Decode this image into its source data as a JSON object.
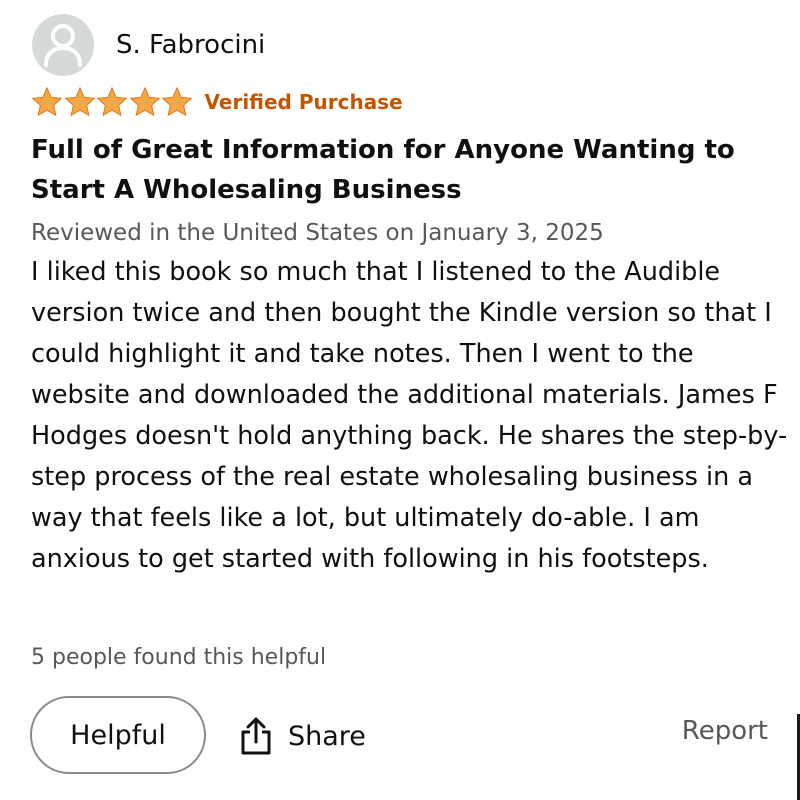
{
  "reviewer": {
    "name": "S. Fabrocini"
  },
  "rating": {
    "stars": 5,
    "max": 5,
    "badge": "Verified Purchase"
  },
  "review": {
    "title": "Full of Great Information for Anyone Wanting to Start A Wholesaling Business",
    "meta": "Reviewed in the United States on January 3, 2025",
    "body": "I liked this book so much that I listened to the Audible version twice and then bought the Kindle version so that I could highlight it and take notes. Then I went to the website and downloaded the additional materials. James F Hodges doesn't hold anything back. He shares the step-by-step process of the real estate wholesaling business in a way that feels like a lot, but ultimately do-able. I am anxious to get started with following in his footsteps."
  },
  "helpful_count": "5 people found this helpful",
  "actions": {
    "helpful_label": "Helpful",
    "share_label": "Share",
    "report_label": "Report"
  },
  "colors": {
    "star": "#f3a847",
    "verified": "#c45500",
    "muted_text": "#565959",
    "avatar_bg": "#d5d9d9",
    "button_border": "#888c8c"
  },
  "icons": {
    "avatar": "user-silhouette-icon",
    "star": "star-icon",
    "share": "share-icon"
  }
}
